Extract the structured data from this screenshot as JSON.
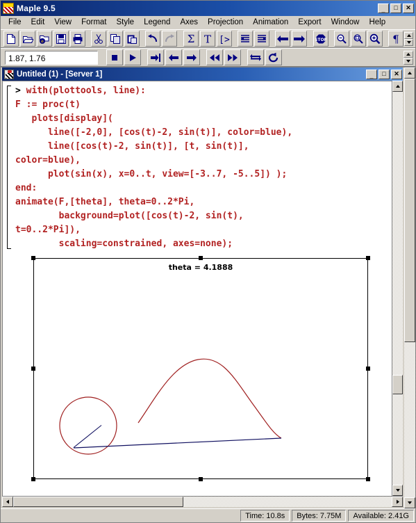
{
  "window": {
    "title": "Maple 9.5",
    "icon": "maple-leaf-icon",
    "minimize_label": "_",
    "maximize_label": "□",
    "close_label": "✕"
  },
  "menubar": {
    "items": [
      {
        "label": "File",
        "name": "menu-file"
      },
      {
        "label": "Edit",
        "name": "menu-edit"
      },
      {
        "label": "View",
        "name": "menu-view"
      },
      {
        "label": "Format",
        "name": "menu-format"
      },
      {
        "label": "Style",
        "name": "menu-style"
      },
      {
        "label": "Legend",
        "name": "menu-legend"
      },
      {
        "label": "Axes",
        "name": "menu-axes"
      },
      {
        "label": "Projection",
        "name": "menu-projection"
      },
      {
        "label": "Animation",
        "name": "menu-animation"
      },
      {
        "label": "Export",
        "name": "menu-export"
      },
      {
        "label": "Window",
        "name": "menu-window"
      },
      {
        "label": "Help",
        "name": "menu-help"
      }
    ]
  },
  "toolbar_main": {
    "buttons": [
      {
        "name": "new-icon",
        "tip": "New"
      },
      {
        "name": "open-icon",
        "tip": "Open"
      },
      {
        "name": "open-url-icon",
        "tip": "Open URL"
      },
      {
        "name": "save-icon",
        "tip": "Save"
      },
      {
        "name": "print-icon",
        "tip": "Print"
      },
      {
        "name": "cut-icon",
        "tip": "Cut"
      },
      {
        "name": "copy-icon",
        "tip": "Copy"
      },
      {
        "name": "paste-icon",
        "tip": "Paste"
      },
      {
        "name": "undo-icon",
        "tip": "Undo"
      },
      {
        "name": "redo-icon",
        "tip": "Redo"
      },
      {
        "name": "sigma-icon",
        "tip": "Insert Math"
      },
      {
        "name": "text-icon",
        "tip": "Insert Text"
      },
      {
        "name": "prompt-icon",
        "tip": "Insert Maple Input"
      },
      {
        "name": "outdent-icon",
        "tip": "Outdent"
      },
      {
        "name": "indent-icon",
        "tip": "Indent"
      },
      {
        "name": "back-icon",
        "tip": "Back"
      },
      {
        "name": "forward-icon",
        "tip": "Forward"
      },
      {
        "name": "stop-icon",
        "tip": "Stop"
      },
      {
        "name": "zoom-out-icon",
        "tip": "Zoom Out"
      },
      {
        "name": "zoom-100-icon",
        "tip": "Zoom 100%"
      },
      {
        "name": "zoom-in-icon",
        "tip": "Zoom In"
      },
      {
        "name": "pilcrow-icon",
        "tip": "Show Markers"
      }
    ]
  },
  "toolbar_animation": {
    "coord_value": "1.87, 1.76",
    "coord_placeholder": "x, y",
    "buttons": [
      {
        "name": "stop-animation-icon",
        "tip": "Stop"
      },
      {
        "name": "play-animation-icon",
        "tip": "Play"
      },
      {
        "name": "next-frame-icon",
        "tip": "Next Frame"
      },
      {
        "name": "prev-step-icon",
        "tip": "Backward"
      },
      {
        "name": "next-step-icon",
        "tip": "Forward"
      },
      {
        "name": "slower-icon",
        "tip": "Slower"
      },
      {
        "name": "faster-icon",
        "tip": "Faster"
      },
      {
        "name": "oscillate-icon",
        "tip": "Oscillate"
      },
      {
        "name": "loop-icon",
        "tip": "Continuous Loop"
      }
    ]
  },
  "document": {
    "title": "Untitled (1) - [Server 1]",
    "icon": "maple-doc-icon",
    "minimize_label": "_",
    "restore_label": "□",
    "close_label": "✕",
    "code_lines": [
      {
        "prompt": "> ",
        "text": "with(plottools, line):"
      },
      {
        "prompt": "",
        "text": "F := proc(t)"
      },
      {
        "prompt": "",
        "text": "   plots[display]("
      },
      {
        "prompt": "",
        "text": "      line([-2,0], [cos(t)-2, sin(t)], color=blue),"
      },
      {
        "prompt": "",
        "text": "      line([cos(t)-2, sin(t)], [t, sin(t)],"
      },
      {
        "prompt": "",
        "text": "color=blue),"
      },
      {
        "prompt": "",
        "text": "      plot(sin(x), x=0..t, view=[-3..7, -5..5]) );"
      },
      {
        "prompt": "",
        "text": "end:"
      },
      {
        "prompt": "",
        "text": "animate(F,[theta], theta=0..2*Pi,"
      },
      {
        "prompt": "",
        "text": "        background=plot([cos(t)-2, sin(t),"
      },
      {
        "prompt": "",
        "text": "t=0..2*Pi]),"
      },
      {
        "prompt": "",
        "text": "        scaling=constrained, axes=none);"
      }
    ]
  },
  "plot": {
    "title": "theta = 4.1888",
    "selected": true,
    "curve_color": "#a02020",
    "line_color": "#101060",
    "background": "#ffffff",
    "handles": [
      "top-left",
      "top-center",
      "top-right",
      "mid-left",
      "mid-right",
      "bottom-left",
      "bottom-center",
      "bottom-right"
    ]
  },
  "scrollbars": {
    "doc_vertical": {
      "name": "document-vertical-scrollbar",
      "thumb_top_pct": 72,
      "thumb_height_pct": 5
    },
    "doc_horizontal": {
      "name": "document-horizontal-scrollbar",
      "thumb_left_pct": 0,
      "thumb_width_pct": 45
    },
    "mdi_vertical": {
      "name": "mdi-vertical-scrollbar",
      "thumb_top_pct": 0,
      "thumb_height_pct": 63
    }
  },
  "statusbar": {
    "time": "Time: 10.8s",
    "bytes": "Bytes: 7.75M",
    "available": "Available: 2.41G"
  }
}
